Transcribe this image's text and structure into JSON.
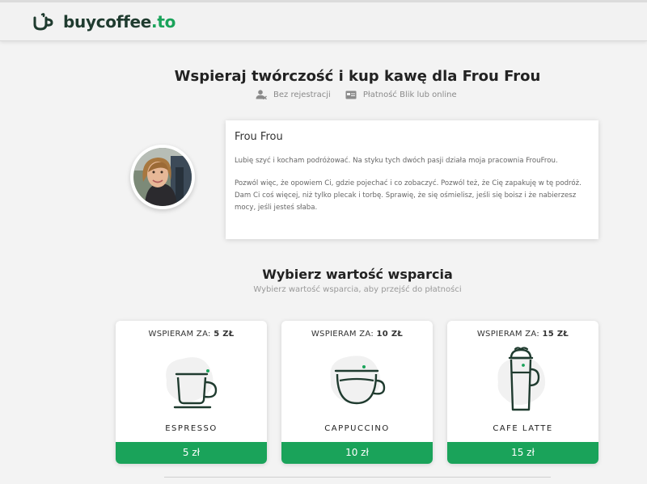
{
  "brand": {
    "name": "buycoffee",
    "tld": ".to",
    "colors": {
      "green": "#1aa35a",
      "dark": "#1f3b2f"
    }
  },
  "hero": {
    "title": "Wspieraj twórczość i kup kawę dla Frou Frou",
    "features": [
      {
        "icon": "user-x-icon",
        "label": "Bez rejestracji"
      },
      {
        "icon": "card-icon",
        "label": "Płatność Blik lub online"
      }
    ]
  },
  "profile": {
    "name": "Frou Frou",
    "bio": [
      "Lubię szyć i kocham podróżować. Na styku tych dwóch pasji działa moja pracownia FrouFrou.",
      "Pozwól więc, że opowiem Ci, gdzie pojechać i co zobaczyć. Pozwól też, że Cię zapakuję w tę podróż. Dam Ci coś więcej, niż tylko plecak i torbę. Sprawię, że się ośmielisz, jeśli się boisz i że nabierzesz mocy, jeśli jesteś słaba."
    ]
  },
  "support": {
    "title": "Wybierz wartość wsparcia",
    "subtitle": "Wybierz wartość wsparcia, aby przejść do płatności",
    "tiers": [
      {
        "prefix": "WSPIERAM ZA: ",
        "amount": "5 ZŁ",
        "name": "ESPRESSO",
        "button": "5 zł",
        "icon": "espresso-cup-icon"
      },
      {
        "prefix": "WSPIERAM ZA: ",
        "amount": "10 ZŁ",
        "name": "CAPPUCCINO",
        "button": "10 zł",
        "icon": "cappuccino-cup-icon"
      },
      {
        "prefix": "WSPIERAM ZA: ",
        "amount": "15 ZŁ",
        "name": "CAFE LATTE",
        "button": "15 zł",
        "icon": "latte-glass-icon"
      }
    ]
  }
}
